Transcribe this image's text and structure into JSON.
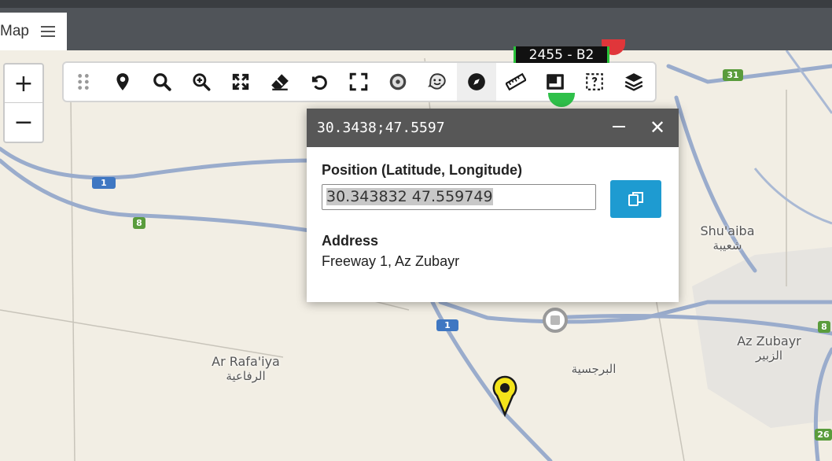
{
  "tab": {
    "label": "Map",
    "menu_icon": "hamburger-icon"
  },
  "zoom": {
    "in_label": "+",
    "out_label": "−"
  },
  "toolbar": {
    "tools": [
      {
        "icon": "drag-handle-icon"
      },
      {
        "icon": "location-pin-icon"
      },
      {
        "icon": "search-icon"
      },
      {
        "icon": "zoom-in-icon"
      },
      {
        "icon": "expand-icon"
      },
      {
        "icon": "eraser-icon"
      },
      {
        "icon": "undo-icon"
      },
      {
        "icon": "fullscreen-icon"
      },
      {
        "icon": "steering-wheel-icon"
      },
      {
        "icon": "waze-icon"
      },
      {
        "icon": "compass-icon"
      },
      {
        "icon": "ruler-icon"
      },
      {
        "icon": "resize-window-icon"
      },
      {
        "icon": "area-query-icon"
      },
      {
        "icon": "layers-icon"
      }
    ]
  },
  "vehicle": {
    "label": "2455 - B2"
  },
  "popup": {
    "title": "30.3438;47.5597",
    "position_label": "Position (Latitude, Longitude)",
    "position_value": "30.343832 47.559749",
    "address_label": "Address",
    "address_value": "Freeway 1, Az Zubayr"
  },
  "map": {
    "places": [
      {
        "en": "Shu'aiba",
        "ar": "شعيبة"
      },
      {
        "en": "Az Zubayr",
        "ar": "الزبير"
      },
      {
        "en": "Ar Rafa'iya",
        "ar": "الرفاعية"
      },
      {
        "en": "",
        "ar": "البرجسية"
      }
    ],
    "shields": [
      "1",
      "8",
      "1",
      "31",
      "8",
      "26"
    ]
  },
  "colors": {
    "road": "#9aaccc",
    "toolbar_active": "#eeeeee",
    "copy_button": "#1e9bd1",
    "popup_header": "#575757"
  }
}
